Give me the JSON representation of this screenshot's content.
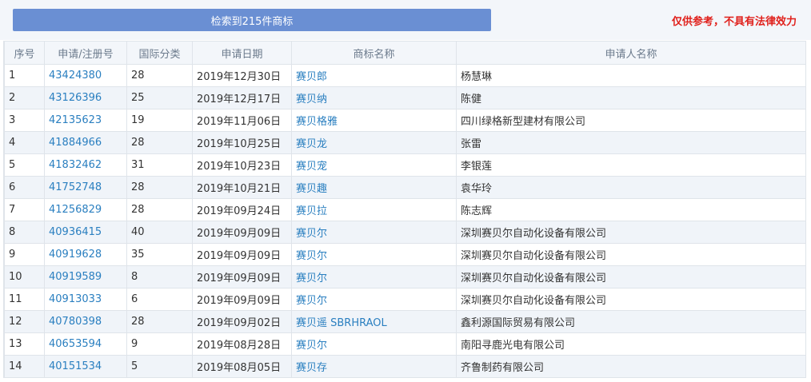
{
  "header": {
    "result_label": "检索到215件商标",
    "disclaimer": "仅供参考，不具有法律效力"
  },
  "table": {
    "columns": [
      "序号",
      "申请/注册号",
      "国际分类",
      "申请日期",
      "商标名称",
      "申请人名称"
    ],
    "rows": [
      {
        "no": "1",
        "reg": "43424380",
        "cls": "28",
        "date": "2019年12月30日",
        "name": "赛贝郎",
        "applicant": "杨慧琳"
      },
      {
        "no": "2",
        "reg": "43126396",
        "cls": "25",
        "date": "2019年12月17日",
        "name": "赛贝纳",
        "applicant": "陈健"
      },
      {
        "no": "3",
        "reg": "42135623",
        "cls": "19",
        "date": "2019年11月06日",
        "name": "赛贝格雅",
        "applicant": "四川绿格新型建材有限公司"
      },
      {
        "no": "4",
        "reg": "41884966",
        "cls": "28",
        "date": "2019年10月25日",
        "name": "赛贝龙",
        "applicant": "张雷"
      },
      {
        "no": "5",
        "reg": "41832462",
        "cls": "31",
        "date": "2019年10月23日",
        "name": "赛贝宠",
        "applicant": "李银莲"
      },
      {
        "no": "6",
        "reg": "41752748",
        "cls": "28",
        "date": "2019年10月21日",
        "name": "赛贝趣",
        "applicant": "袁华玲"
      },
      {
        "no": "7",
        "reg": "41256829",
        "cls": "28",
        "date": "2019年09月24日",
        "name": "赛贝拉",
        "applicant": "陈志辉"
      },
      {
        "no": "8",
        "reg": "40936415",
        "cls": "40",
        "date": "2019年09月09日",
        "name": "赛贝尔",
        "applicant": "深圳赛贝尔自动化设备有限公司"
      },
      {
        "no": "9",
        "reg": "40919628",
        "cls": "35",
        "date": "2019年09月09日",
        "name": "赛贝尔",
        "applicant": "深圳赛贝尔自动化设备有限公司"
      },
      {
        "no": "10",
        "reg": "40919589",
        "cls": "8",
        "date": "2019年09月09日",
        "name": "赛贝尔",
        "applicant": "深圳赛贝尔自动化设备有限公司"
      },
      {
        "no": "11",
        "reg": "40913033",
        "cls": "6",
        "date": "2019年09月09日",
        "name": "赛贝尔",
        "applicant": "深圳赛贝尔自动化设备有限公司"
      },
      {
        "no": "12",
        "reg": "40780398",
        "cls": "28",
        "date": "2019年09月02日",
        "name": "赛贝遥 SBRHRAOL",
        "applicant": "鑫利源国际贸易有限公司"
      },
      {
        "no": "13",
        "reg": "40653594",
        "cls": "9",
        "date": "2019年08月28日",
        "name": "赛贝尔",
        "applicant": "南阳寻鹿光电有限公司"
      },
      {
        "no": "14",
        "reg": "40151534",
        "cls": "5",
        "date": "2019年08月05日",
        "name": "赛贝存",
        "applicant": "齐鲁制药有限公司"
      }
    ]
  },
  "colors": {
    "button": "#6a8fd3",
    "disclaimer": "#e0201b",
    "link": "#2a7fc0",
    "header_bg": "#f3f6fa",
    "alt_row_bg": "#f0f4f9"
  }
}
